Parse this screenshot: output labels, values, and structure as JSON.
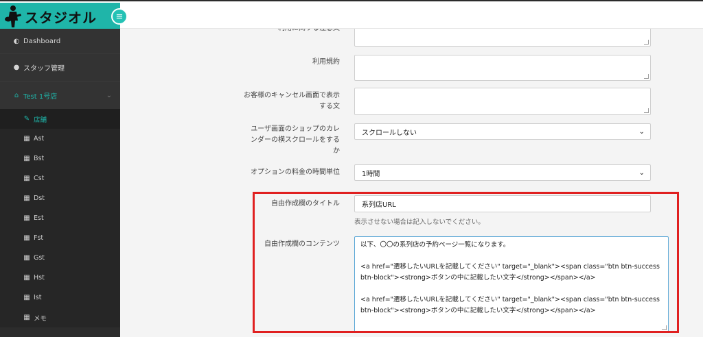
{
  "brand": {
    "title": "スタジオル"
  },
  "sidebar": {
    "top_items": [
      {
        "icon": "dashboard-icon",
        "label": "Dashboard"
      },
      {
        "icon": "user-icon",
        "label": "スタッフ管理"
      }
    ],
    "group": {
      "icon": "home-icon",
      "label": "Test 1号店"
    },
    "sub_items": [
      {
        "icon": "wrench-icon",
        "label": "店舗",
        "active": true
      },
      {
        "icon": "calendar-icon",
        "label": "Ast"
      },
      {
        "icon": "calendar-icon",
        "label": "Bst"
      },
      {
        "icon": "calendar-icon",
        "label": "Cst"
      },
      {
        "icon": "calendar-icon",
        "label": "Dst"
      },
      {
        "icon": "calendar-icon",
        "label": "Est"
      },
      {
        "icon": "calendar-icon",
        "label": "Fst"
      },
      {
        "icon": "calendar-icon",
        "label": "Gst"
      },
      {
        "icon": "calendar-icon",
        "label": "Hst"
      },
      {
        "icon": "calendar-icon",
        "label": "Ist"
      },
      {
        "icon": "calendar-icon",
        "label": "メモ"
      }
    ]
  },
  "form": {
    "row0_label": "利用に関する注意文",
    "terms_label": "利用規約",
    "cancel_label": "お客様のキャンセル画面で表示する文",
    "scroll_label": "ユーザ画面のショップのカレンダーの横スクロールをするか",
    "scroll_value": "スクロールしない",
    "option_label": "オプションの料金の時間単位",
    "option_value": "1時間",
    "free_title_label": "自由作成欄のタイトル",
    "free_title_value": "系列店URL",
    "free_title_help": "表示させない場合は記入しないでください。",
    "free_content_label": "自由作成欄のコンテンツ",
    "free_content_lines": [
      "以下、〇〇の系列店の予約ページ一覧になります。",
      "<a href=\"遷移したいURLを記載してください\" target=\"_blank\"><span class=\"btn btn-success btn-block\"><strong>ボタンの中に記載したい文字</strong></span></a>",
      "<a href=\"遷移したいURLを記載してください\" target=\"_blank\"><span class=\"btn btn-success btn-block\"><strong>ボタンの中に記載したい文字</strong></span></a>"
    ]
  },
  "colors": {
    "accent": "#1fb5a9",
    "sidebar_bg": "#2c2c2c",
    "highlight": "#e02020"
  }
}
